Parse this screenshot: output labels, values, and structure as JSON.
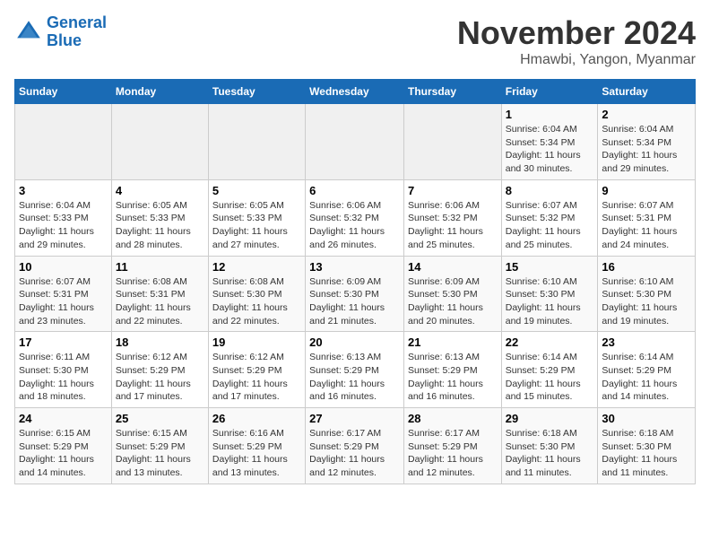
{
  "header": {
    "logo_line1": "General",
    "logo_line2": "Blue",
    "title": "November 2024",
    "subtitle": "Hmawbi, Yangon, Myanmar"
  },
  "days_of_week": [
    "Sunday",
    "Monday",
    "Tuesday",
    "Wednesday",
    "Thursday",
    "Friday",
    "Saturday"
  ],
  "weeks": [
    [
      {
        "day": "",
        "detail": ""
      },
      {
        "day": "",
        "detail": ""
      },
      {
        "day": "",
        "detail": ""
      },
      {
        "day": "",
        "detail": ""
      },
      {
        "day": "",
        "detail": ""
      },
      {
        "day": "1",
        "detail": "Sunrise: 6:04 AM\nSunset: 5:34 PM\nDaylight: 11 hours and 30 minutes."
      },
      {
        "day": "2",
        "detail": "Sunrise: 6:04 AM\nSunset: 5:34 PM\nDaylight: 11 hours and 29 minutes."
      }
    ],
    [
      {
        "day": "3",
        "detail": "Sunrise: 6:04 AM\nSunset: 5:33 PM\nDaylight: 11 hours and 29 minutes."
      },
      {
        "day": "4",
        "detail": "Sunrise: 6:05 AM\nSunset: 5:33 PM\nDaylight: 11 hours and 28 minutes."
      },
      {
        "day": "5",
        "detail": "Sunrise: 6:05 AM\nSunset: 5:33 PM\nDaylight: 11 hours and 27 minutes."
      },
      {
        "day": "6",
        "detail": "Sunrise: 6:06 AM\nSunset: 5:32 PM\nDaylight: 11 hours and 26 minutes."
      },
      {
        "day": "7",
        "detail": "Sunrise: 6:06 AM\nSunset: 5:32 PM\nDaylight: 11 hours and 25 minutes."
      },
      {
        "day": "8",
        "detail": "Sunrise: 6:07 AM\nSunset: 5:32 PM\nDaylight: 11 hours and 25 minutes."
      },
      {
        "day": "9",
        "detail": "Sunrise: 6:07 AM\nSunset: 5:31 PM\nDaylight: 11 hours and 24 minutes."
      }
    ],
    [
      {
        "day": "10",
        "detail": "Sunrise: 6:07 AM\nSunset: 5:31 PM\nDaylight: 11 hours and 23 minutes."
      },
      {
        "day": "11",
        "detail": "Sunrise: 6:08 AM\nSunset: 5:31 PM\nDaylight: 11 hours and 22 minutes."
      },
      {
        "day": "12",
        "detail": "Sunrise: 6:08 AM\nSunset: 5:30 PM\nDaylight: 11 hours and 22 minutes."
      },
      {
        "day": "13",
        "detail": "Sunrise: 6:09 AM\nSunset: 5:30 PM\nDaylight: 11 hours and 21 minutes."
      },
      {
        "day": "14",
        "detail": "Sunrise: 6:09 AM\nSunset: 5:30 PM\nDaylight: 11 hours and 20 minutes."
      },
      {
        "day": "15",
        "detail": "Sunrise: 6:10 AM\nSunset: 5:30 PM\nDaylight: 11 hours and 19 minutes."
      },
      {
        "day": "16",
        "detail": "Sunrise: 6:10 AM\nSunset: 5:30 PM\nDaylight: 11 hours and 19 minutes."
      }
    ],
    [
      {
        "day": "17",
        "detail": "Sunrise: 6:11 AM\nSunset: 5:30 PM\nDaylight: 11 hours and 18 minutes."
      },
      {
        "day": "18",
        "detail": "Sunrise: 6:12 AM\nSunset: 5:29 PM\nDaylight: 11 hours and 17 minutes."
      },
      {
        "day": "19",
        "detail": "Sunrise: 6:12 AM\nSunset: 5:29 PM\nDaylight: 11 hours and 17 minutes."
      },
      {
        "day": "20",
        "detail": "Sunrise: 6:13 AM\nSunset: 5:29 PM\nDaylight: 11 hours and 16 minutes."
      },
      {
        "day": "21",
        "detail": "Sunrise: 6:13 AM\nSunset: 5:29 PM\nDaylight: 11 hours and 16 minutes."
      },
      {
        "day": "22",
        "detail": "Sunrise: 6:14 AM\nSunset: 5:29 PM\nDaylight: 11 hours and 15 minutes."
      },
      {
        "day": "23",
        "detail": "Sunrise: 6:14 AM\nSunset: 5:29 PM\nDaylight: 11 hours and 14 minutes."
      }
    ],
    [
      {
        "day": "24",
        "detail": "Sunrise: 6:15 AM\nSunset: 5:29 PM\nDaylight: 11 hours and 14 minutes."
      },
      {
        "day": "25",
        "detail": "Sunrise: 6:15 AM\nSunset: 5:29 PM\nDaylight: 11 hours and 13 minutes."
      },
      {
        "day": "26",
        "detail": "Sunrise: 6:16 AM\nSunset: 5:29 PM\nDaylight: 11 hours and 13 minutes."
      },
      {
        "day": "27",
        "detail": "Sunrise: 6:17 AM\nSunset: 5:29 PM\nDaylight: 11 hours and 12 minutes."
      },
      {
        "day": "28",
        "detail": "Sunrise: 6:17 AM\nSunset: 5:29 PM\nDaylight: 11 hours and 12 minutes."
      },
      {
        "day": "29",
        "detail": "Sunrise: 6:18 AM\nSunset: 5:30 PM\nDaylight: 11 hours and 11 minutes."
      },
      {
        "day": "30",
        "detail": "Sunrise: 6:18 AM\nSunset: 5:30 PM\nDaylight: 11 hours and 11 minutes."
      }
    ]
  ]
}
